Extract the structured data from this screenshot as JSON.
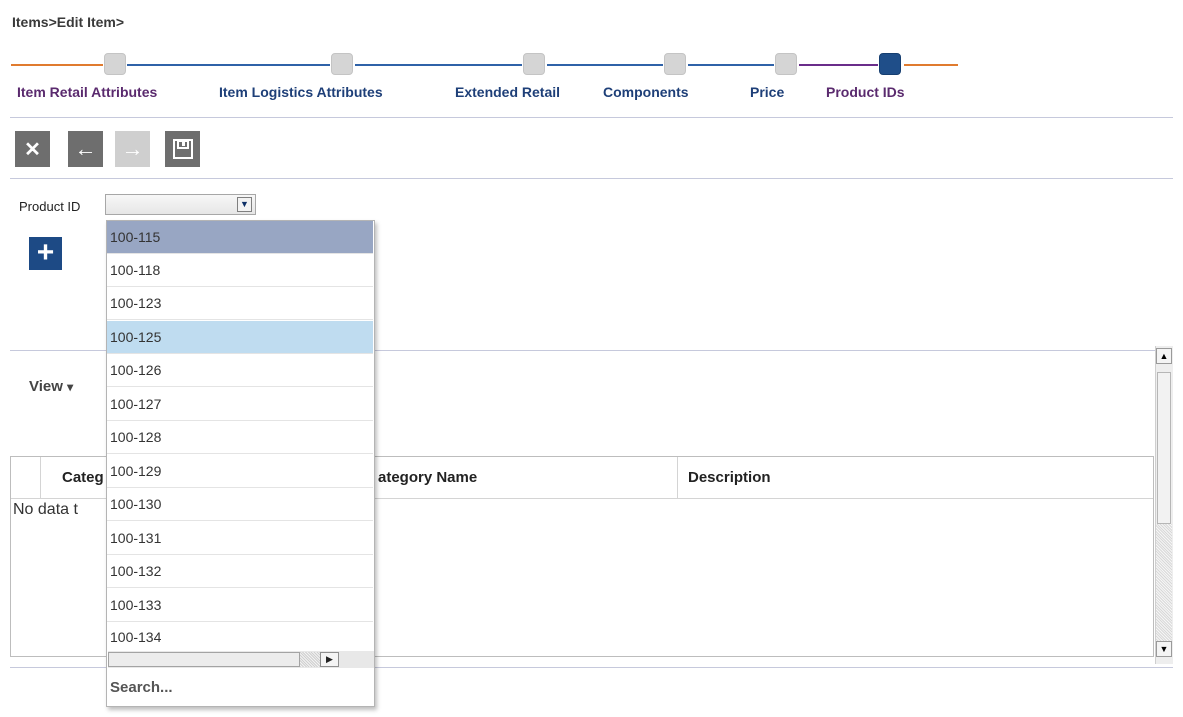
{
  "breadcrumb": {
    "items": "Items",
    "sep1": ">",
    "edit_item": "Edit Item",
    "sep2": ">"
  },
  "train": {
    "steps": [
      {
        "label": "Item Retail Attributes",
        "state": "visited"
      },
      {
        "label": "Item Logistics Attributes",
        "state": "visited"
      },
      {
        "label": "Extended Retail",
        "state": "visited"
      },
      {
        "label": "Components",
        "state": "visited"
      },
      {
        "label": "Price",
        "state": "visited"
      },
      {
        "label": "Product IDs",
        "state": "current"
      }
    ],
    "colors": {
      "visited_line": "#e07b2f",
      "link_line": "#2f62a8",
      "current": "#1f4e89",
      "purple_line": "#6a2d8a"
    }
  },
  "toolbar": {
    "cancel_icon": "close-icon",
    "back_icon": "arrow-left-icon",
    "next_icon": "arrow-right-icon",
    "save_icon": "save-icon"
  },
  "form": {
    "product_id_label": "Product ID",
    "product_id_value": "",
    "add_icon": "plus-icon"
  },
  "view_menu": {
    "label": "View",
    "arrow": "▾"
  },
  "table": {
    "columns": [
      "Categ",
      "ategory Name",
      "Description"
    ],
    "empty_message": "No data t"
  },
  "dropdown": {
    "options": [
      "100-115",
      "100-118",
      "100-123",
      "100-125",
      "100-126",
      "100-127",
      "100-128",
      "100-129",
      "100-130",
      "100-131",
      "100-132",
      "100-133",
      "100-134"
    ],
    "selected": "100-115",
    "hovered": "100-125",
    "search_label": "Search..."
  }
}
